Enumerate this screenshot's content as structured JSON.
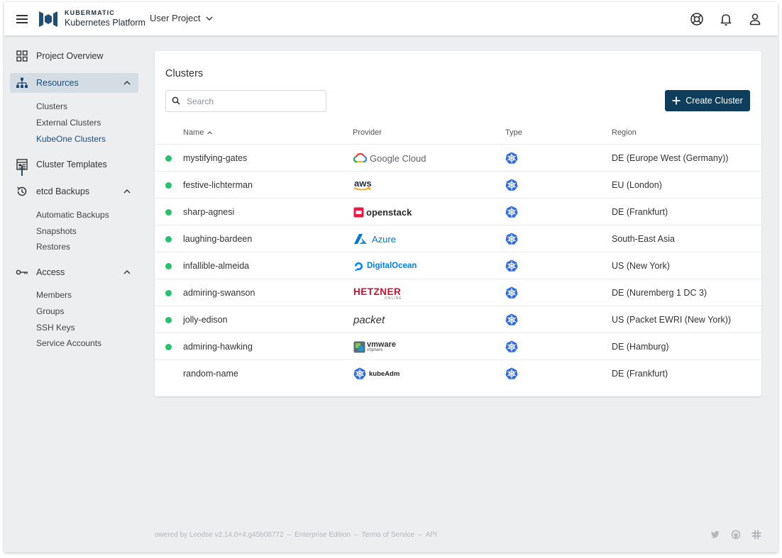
{
  "header": {
    "brand_top": "KUBERMATIC",
    "brand_bottom": "Kubernetes Platform",
    "project": "User Project"
  },
  "sidebar": {
    "items": [
      {
        "label": "Project Overview",
        "icon": "grid-icon"
      },
      {
        "label": "Resources",
        "icon": "sitemap-icon"
      },
      {
        "label": "Cluster Templates",
        "icon": "template-icon"
      },
      {
        "label": "etcd Backups",
        "icon": "history-icon"
      },
      {
        "label": "Access",
        "icon": "key-icon"
      }
    ],
    "resources_sub": [
      "Clusters",
      "External Clusters",
      "KubeOne Clusters"
    ],
    "backups_sub": [
      "Automatic Backups",
      "Snapshots",
      "Restores"
    ],
    "access_sub": [
      "Members",
      "Groups",
      "SSH Keys",
      "Service Accounts"
    ]
  },
  "main": {
    "title": "Clusters",
    "search_placeholder": "Search",
    "create_label": "Create Cluster",
    "columns": {
      "name": "Name",
      "provider": "Provider",
      "type": "Type",
      "region": "Region"
    },
    "rows": [
      {
        "name": "mystifying-gates",
        "provider": "Google Cloud",
        "region": "DE (Europe West (Germany))",
        "status": "running"
      },
      {
        "name": "festive-lichterman",
        "provider": "aws",
        "region": "EU (London)",
        "status": "running"
      },
      {
        "name": "sharp-agnesi",
        "provider": "openstack",
        "region": "DE (Frankfurt)",
        "status": "running"
      },
      {
        "name": "laughing-bardeen",
        "provider": "Azure",
        "region": "South-East Asia",
        "status": "running"
      },
      {
        "name": "infallible-almeida",
        "provider": "DigitalOcean",
        "region": "US (New York)",
        "status": "running"
      },
      {
        "name": "admiring-swanson",
        "provider": "HETZNER",
        "provider_sub": "ONLINE",
        "region": "DE (Nuremberg 1 DC 3)",
        "status": "running"
      },
      {
        "name": "jolly-edison",
        "provider": "packet",
        "region": "US (Packet EWRI (New York))",
        "status": "running"
      },
      {
        "name": "admiring-hawking",
        "provider": "vmware",
        "provider_sub": "vSphere",
        "region": "DE (Hamburg)",
        "status": "running"
      },
      {
        "name": "random-name",
        "provider": "kubeAdm",
        "region": "DE (Frankfurt)",
        "status": "none"
      }
    ]
  },
  "footer": {
    "version": "owered by Loodse v2.14.0+4.g45b08772",
    "edition": "Enterprise Edition",
    "tos": "Terms of Service",
    "api": "API",
    "sep": "–"
  },
  "colors": {
    "accent": "#0f3d5c",
    "status_running": "#27c26c",
    "active_nav_bg": "#d3dde3",
    "kube_blue": "#326ce5"
  }
}
